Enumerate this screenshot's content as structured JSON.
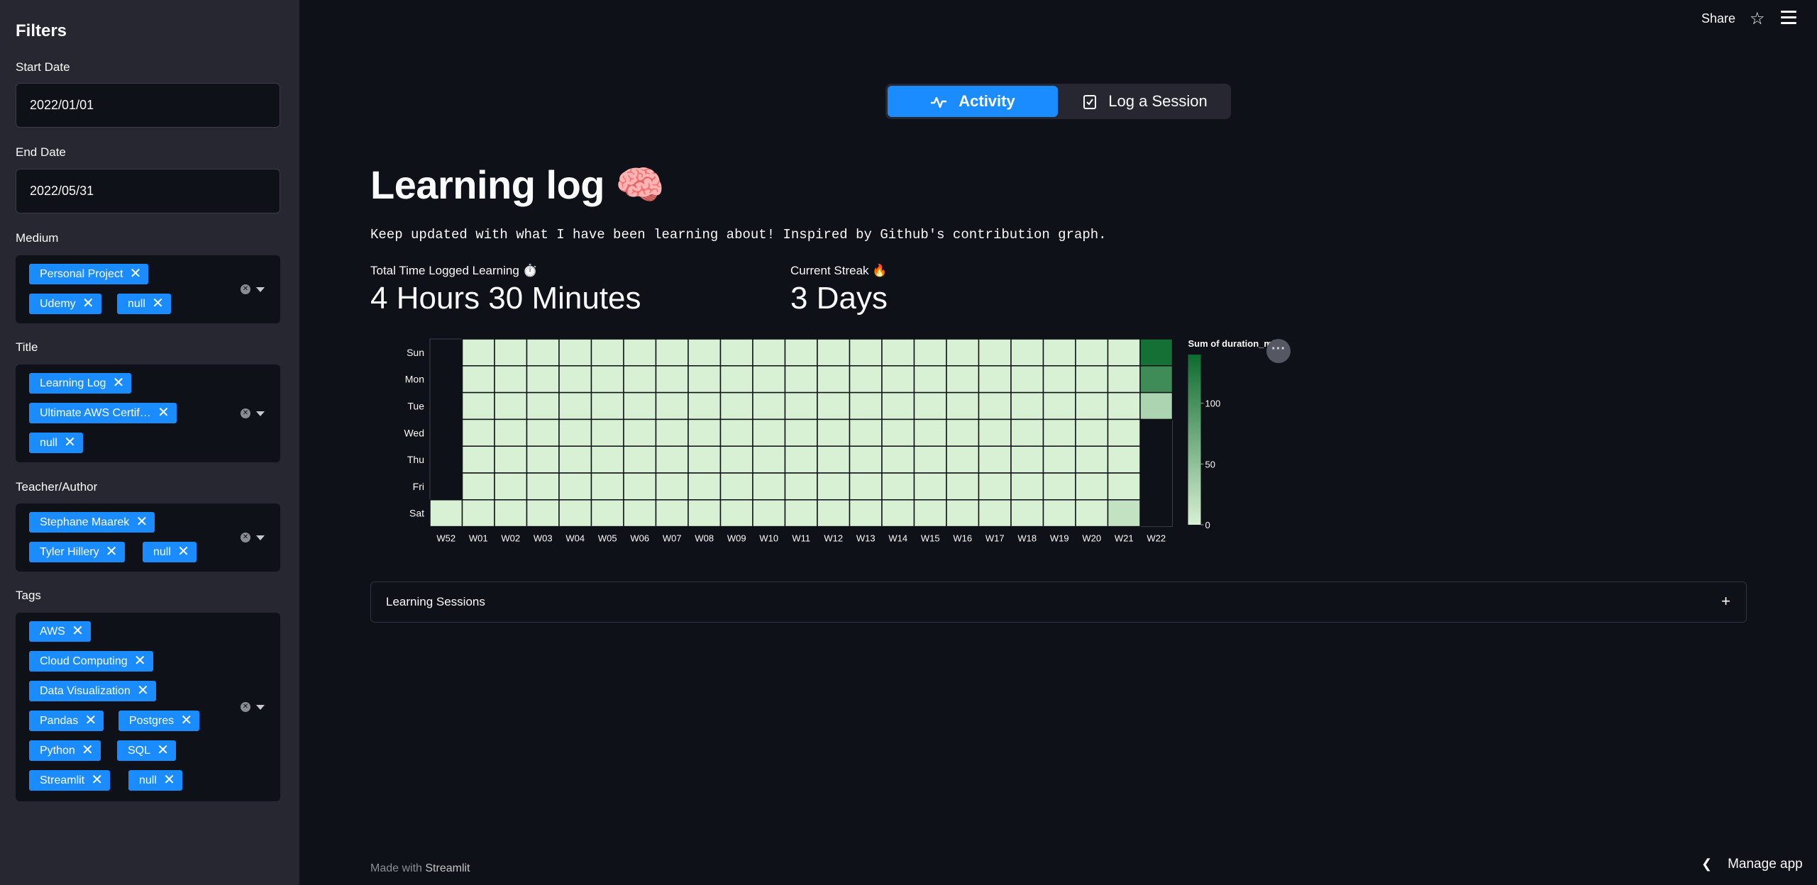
{
  "sidebar": {
    "title": "Filters",
    "start_date": {
      "label": "Start Date",
      "value": "2022/01/01"
    },
    "end_date": {
      "label": "End Date",
      "value": "2022/05/31"
    },
    "medium": {
      "label": "Medium",
      "chips": [
        "Personal Project",
        "Udemy",
        "null"
      ]
    },
    "title_filter": {
      "label": "Title",
      "chips": [
        "Learning Log",
        "Ultimate AWS Certif…",
        "null"
      ]
    },
    "teacher": {
      "label": "Teacher/Author",
      "chips": [
        "Stephane Maarek",
        "Tyler Hillery",
        "null"
      ]
    },
    "tags": {
      "label": "Tags",
      "chips": [
        "AWS",
        "Cloud Computing",
        "Data Visualization",
        "Pandas",
        "Postgres",
        "Python",
        "SQL",
        "Streamlit",
        "null"
      ]
    }
  },
  "header": {
    "share": "Share"
  },
  "toggle": {
    "activity": "Activity",
    "log": "Log a Session"
  },
  "main": {
    "title": "Learning log 🧠",
    "subtitle": "Keep updated with what I have been learning about! Inspired by Github's contribution graph.",
    "metric1": {
      "label": "Total Time Logged Learning ⏱️",
      "value": "4 Hours 30 Minutes"
    },
    "metric2": {
      "label": "Current Streak 🔥",
      "value": "3 Days"
    }
  },
  "expander": {
    "label": "Learning Sessions"
  },
  "footer": {
    "made_with": "Made with",
    "brand": "Streamlit",
    "manage": "Manage app"
  },
  "chart_data": {
    "type": "heatmap",
    "days": [
      "Sun",
      "Mon",
      "Tue",
      "Wed",
      "Thu",
      "Fri",
      "Sat"
    ],
    "weeks": [
      "W52",
      "W01",
      "W02",
      "W03",
      "W04",
      "W05",
      "W06",
      "W07",
      "W08",
      "W09",
      "W10",
      "W11",
      "W12",
      "W13",
      "W14",
      "W15",
      "W16",
      "W17",
      "W18",
      "W19",
      "W20",
      "W21",
      "W22"
    ],
    "legend_title": "Sum of duration_min",
    "legend_ticks": [
      0,
      50,
      100
    ],
    "scale_max": 140,
    "colors": {
      "low": "#d8f0d3",
      "high": "#0d6b2f",
      "empty": "#0e1117",
      "grid": "#0e1117"
    },
    "cells": [
      {
        "week": "W52",
        "day": "Sat",
        "value": 0
      },
      {
        "week": "W21",
        "day": "Sat",
        "value": 15
      },
      {
        "week": "W22",
        "day": "Sun",
        "value": 135
      },
      {
        "week": "W22",
        "day": "Mon",
        "value": 105
      },
      {
        "week": "W22",
        "day": "Tue",
        "value": 30
      }
    ],
    "fill_range": {
      "from_week": "W01",
      "to_week": "W21",
      "value": 0
    },
    "w22_days": [
      "Sun",
      "Mon",
      "Tue"
    ]
  }
}
